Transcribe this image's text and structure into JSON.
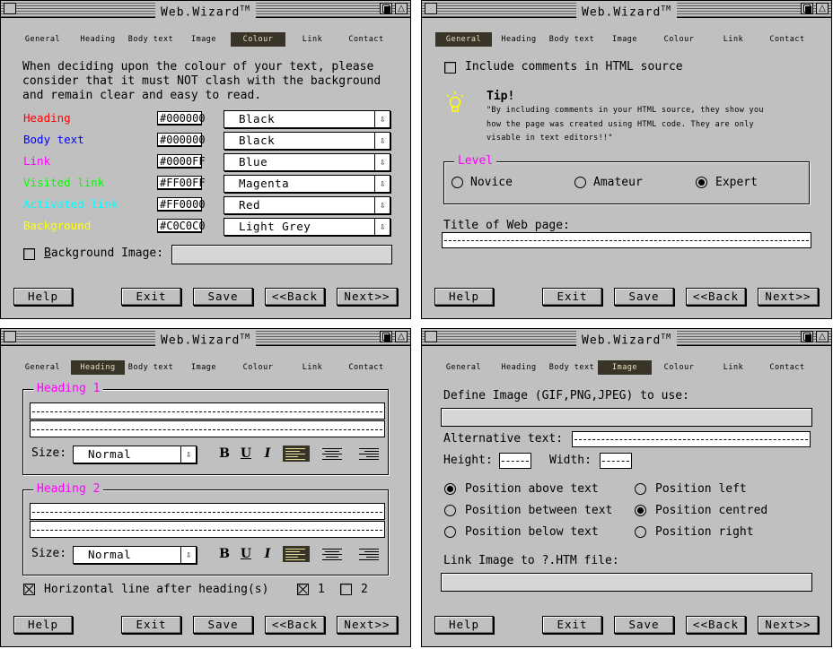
{
  "window_title": "Web.Wizard",
  "trademark": "TM",
  "tabs": [
    "General",
    "Heading",
    "Body text",
    "Image",
    "Colour",
    "Link",
    "Contact"
  ],
  "buttons": {
    "help": "Help",
    "exit": "Exit",
    "save": "Save",
    "back": "<<Back",
    "next": "Next>>"
  },
  "colour_panel": {
    "intro": "When deciding upon the colour of your text, please\nconsider that it must NOT clash with the background\nand remain clear and easy to read.",
    "rows": [
      {
        "label": "Heading",
        "hex": "#000000",
        "choice": "Black",
        "color": "#ff0000"
      },
      {
        "label": "Body text",
        "hex": "#000000",
        "choice": "Black",
        "color": "#0000ff"
      },
      {
        "label": "Link",
        "hex": "#0000FF",
        "choice": "Blue",
        "color": "#ff00ff"
      },
      {
        "label": "Visited link",
        "hex": "#FF00FF",
        "choice": "Magenta",
        "color": "#00ff00"
      },
      {
        "label": "Activated link",
        "hex": "#FF0000",
        "choice": "Red",
        "color": "#00ffff"
      },
      {
        "label": "Background",
        "hex": "#C0C0C0",
        "choice": "Light Grey",
        "color": "#ffff00"
      }
    ],
    "bg_image_label": "Background Image:",
    "bg_image_value": ""
  },
  "general_panel": {
    "include_comments": "Include comments in HTML source",
    "tip_title": "Tip!",
    "tip_text": "\"By including comments in your HTML source, they show you\nhow the page was created using HTML code.  They are only\nvisable in text editors!!\"",
    "level_label": "Level",
    "levels": [
      "Novice",
      "Amateur",
      "Expert"
    ],
    "level_selected": "Expert",
    "title_label": "Title of Web page:",
    "title_value": ""
  },
  "heading_panel": {
    "heading1": "Heading 1",
    "heading2": "Heading 2",
    "size_label": "Size:",
    "size_value": "Normal",
    "bold": "B",
    "underline": "U",
    "italic": "I",
    "hline_label": "Horizontal line after heading(s)",
    "opt1": "1",
    "opt2": "2"
  },
  "image_panel": {
    "define_label": "Define Image (GIF,PNG,JPEG) to use:",
    "alt_label": "Alternative text:",
    "height_label": "Height:",
    "width_label": "Width:",
    "positions": [
      "Position above text",
      "Position between text",
      "Position below text",
      "Position left",
      "Position centred",
      "Position right"
    ],
    "position_selected": [
      "Position above text",
      "Position centred"
    ],
    "link_label": "Link Image to ?.HTM file:"
  },
  "colors": {
    "window_bg": "#c0c0c0",
    "active_tab": "#383428",
    "active_tab_text": "#e8e0c0",
    "group_label": "#ff00ff",
    "tip_bulb": "#ffff00"
  }
}
